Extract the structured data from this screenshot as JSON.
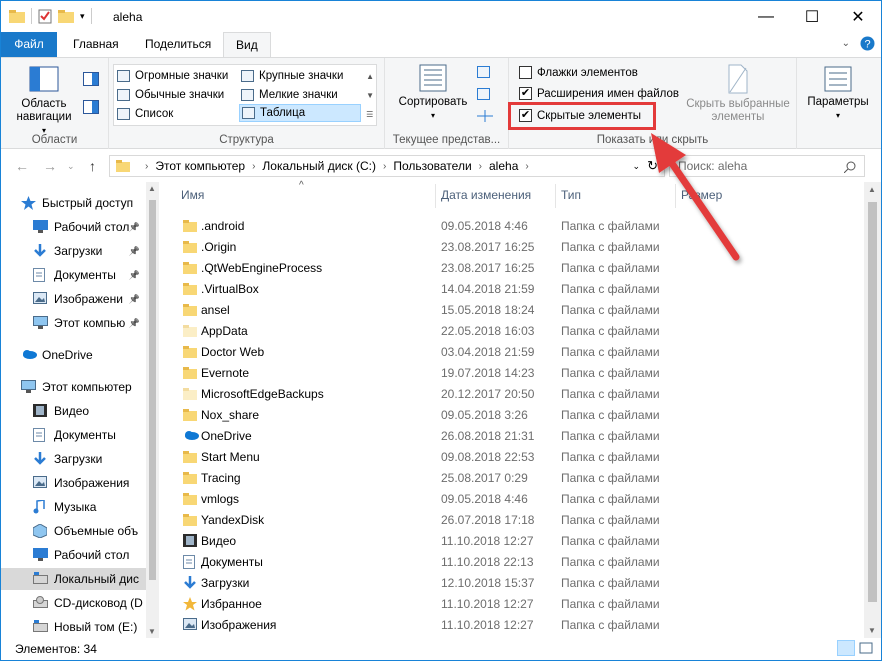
{
  "window": {
    "title": "aleha"
  },
  "tabs": {
    "file": "Файл",
    "home": "Главная",
    "share": "Поделиться",
    "view": "Вид"
  },
  "ribbon": {
    "areas": {
      "nav_pane": "Область навигации",
      "label": "Области"
    },
    "layout": {
      "items": [
        "Огромные значки",
        "Крупные значки",
        "Обычные значки",
        "Мелкие значки",
        "Список",
        "Таблица"
      ],
      "selected": "Таблица",
      "label": "Структура"
    },
    "current_view": {
      "sort": "Сортировать",
      "label": "Текущее представ..."
    },
    "show_hide": {
      "item_checkboxes": "Флажки элементов",
      "file_extensions": "Расширения имен файлов",
      "hidden_items": "Скрытые элементы",
      "hide_selected": "Скрыть выбранные элементы",
      "label": "Показать или скрыть",
      "checked": {
        "item_checkboxes": false,
        "file_extensions": true,
        "hidden_items": true
      }
    },
    "options": {
      "label": "Параметры"
    }
  },
  "address": {
    "crumbs": [
      "Этот компьютер",
      "Локальный диск (C:)",
      "Пользователи",
      "aleha"
    ]
  },
  "search": {
    "placeholder": "Поиск: aleha"
  },
  "sidebar": {
    "items": [
      {
        "label": "Быстрый доступ",
        "icon": "star-icon"
      },
      {
        "label": "Рабочий стол",
        "icon": "desktop-icon",
        "pinned": true
      },
      {
        "label": "Загрузки",
        "icon": "download-icon",
        "pinned": true
      },
      {
        "label": "Документы",
        "icon": "documents-icon",
        "pinned": true
      },
      {
        "label": "Изображени",
        "icon": "pictures-icon",
        "pinned": true
      },
      {
        "label": "Этот компью",
        "icon": "computer-icon",
        "pinned": true
      },
      {
        "label": "OneDrive",
        "icon": "onedrive-icon"
      },
      {
        "label": "Этот компьютер",
        "icon": "computer-icon"
      },
      {
        "label": "Видео",
        "icon": "video-icon"
      },
      {
        "label": "Документы",
        "icon": "documents-icon"
      },
      {
        "label": "Загрузки",
        "icon": "download-icon"
      },
      {
        "label": "Изображения",
        "icon": "pictures-icon"
      },
      {
        "label": "Музыка",
        "icon": "music-icon"
      },
      {
        "label": "Объемные объ",
        "icon": "3d-objects-icon"
      },
      {
        "label": "Рабочий стол",
        "icon": "desktop-icon"
      },
      {
        "label": "Локальный дис",
        "icon": "drive-icon",
        "selected": true
      },
      {
        "label": "CD-дисковод (D",
        "icon": "cd-drive-icon"
      },
      {
        "label": "Новый том (E:)",
        "icon": "drive-icon"
      }
    ]
  },
  "columns": {
    "name": "Имя",
    "date": "Дата изменения",
    "type": "Тип",
    "size": "Размер"
  },
  "files": [
    {
      "name": ".android",
      "date": "09.05.2018 4:46",
      "type": "Папка с файлами",
      "icon": "folder-icon"
    },
    {
      "name": ".Origin",
      "date": "23.08.2017 16:25",
      "type": "Папка с файлами",
      "icon": "folder-icon"
    },
    {
      "name": ".QtWebEngineProcess",
      "date": "23.08.2017 16:25",
      "type": "Папка с файлами",
      "icon": "folder-icon"
    },
    {
      "name": ".VirtualBox",
      "date": "14.04.2018 21:59",
      "type": "Папка с файлами",
      "icon": "folder-icon"
    },
    {
      "name": "ansel",
      "date": "15.05.2018 18:24",
      "type": "Папка с файлами",
      "icon": "folder-icon"
    },
    {
      "name": "AppData",
      "date": "22.05.2018 16:03",
      "type": "Папка с файлами",
      "icon": "hidden-folder-icon"
    },
    {
      "name": "Doctor Web",
      "date": "03.04.2018 21:59",
      "type": "Папка с файлами",
      "icon": "folder-icon"
    },
    {
      "name": "Evernote",
      "date": "19.07.2018 14:23",
      "type": "Папка с файлами",
      "icon": "folder-icon"
    },
    {
      "name": "MicrosoftEdgeBackups",
      "date": "20.12.2017 20:50",
      "type": "Папка с файлами",
      "icon": "hidden-folder-icon"
    },
    {
      "name": "Nox_share",
      "date": "09.05.2018 3:26",
      "type": "Папка с файлами",
      "icon": "folder-icon"
    },
    {
      "name": "OneDrive",
      "date": "26.08.2018 21:31",
      "type": "Папка с файлами",
      "icon": "onedrive-icon"
    },
    {
      "name": "Start Menu",
      "date": "09.08.2018 22:53",
      "type": "Папка с файлами",
      "icon": "folder-icon"
    },
    {
      "name": "Tracing",
      "date": "25.08.2017 0:29",
      "type": "Папка с файлами",
      "icon": "folder-icon"
    },
    {
      "name": "vmlogs",
      "date": "09.05.2018 4:46",
      "type": "Папка с файлами",
      "icon": "folder-icon"
    },
    {
      "name": "YandexDisk",
      "date": "26.07.2018 17:18",
      "type": "Папка с файлами",
      "icon": "folder-icon"
    },
    {
      "name": "Видео",
      "date": "11.10.2018 12:27",
      "type": "Папка с файлами",
      "icon": "video-icon"
    },
    {
      "name": "Документы",
      "date": "11.10.2018 22:13",
      "type": "Папка с файлами",
      "icon": "documents-icon"
    },
    {
      "name": "Загрузки",
      "date": "12.10.2018 15:37",
      "type": "Папка с файлами",
      "icon": "download-icon"
    },
    {
      "name": "Избранное",
      "date": "11.10.2018 12:27",
      "type": "Папка с файлами",
      "icon": "favorites-icon"
    },
    {
      "name": "Изображения",
      "date": "11.10.2018 12:27",
      "type": "Папка с файлами",
      "icon": "pictures-icon"
    }
  ],
  "status": {
    "count": "Элементов: 34"
  },
  "annotation": {
    "highlight_color": "#e33a3a"
  }
}
